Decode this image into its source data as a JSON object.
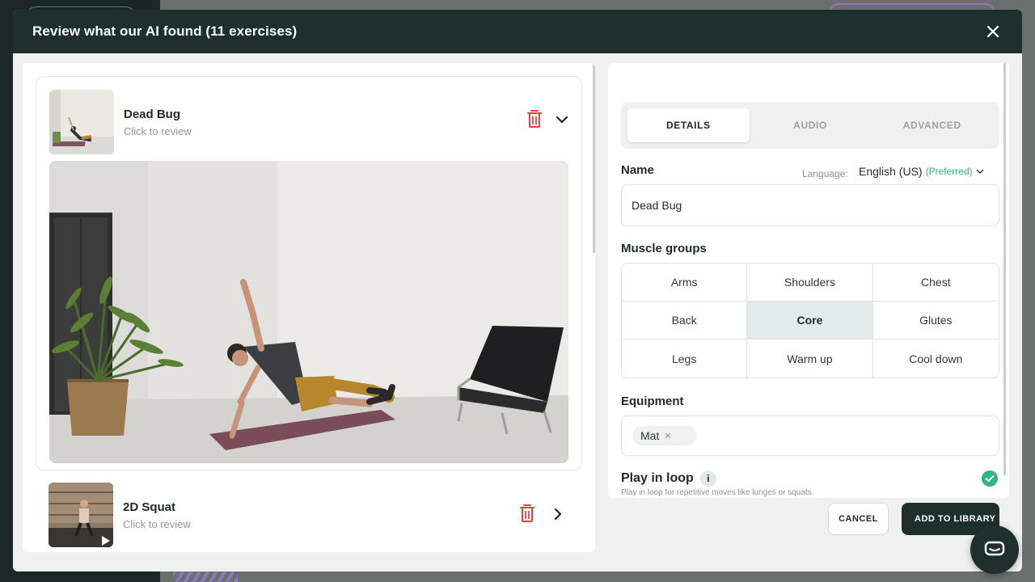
{
  "modal": {
    "title": "Review what our AI found (11 exercises)"
  },
  "exercises": [
    {
      "name": "Dead Bug",
      "subtitle": "Click to review",
      "expanded": true
    },
    {
      "name": "2D Squat",
      "subtitle": "Click to review",
      "expanded": false
    }
  ],
  "details": {
    "tabs": [
      {
        "label": "DETAILS",
        "active": true
      },
      {
        "label": "AUDIO",
        "active": false
      },
      {
        "label": "ADVANCED",
        "active": false
      }
    ],
    "name_label": "Name",
    "language_label": "Language:",
    "language_value": "English (US)",
    "language_preferred": "(Preferred)",
    "name_value": "Dead Bug",
    "muscle_groups_label": "Muscle groups",
    "muscle_groups": [
      {
        "label": "Arms",
        "selected": false
      },
      {
        "label": "Shoulders",
        "selected": false
      },
      {
        "label": "Chest",
        "selected": false
      },
      {
        "label": "Back",
        "selected": false
      },
      {
        "label": "Core",
        "selected": true
      },
      {
        "label": "Glutes",
        "selected": false
      },
      {
        "label": "Legs",
        "selected": false
      },
      {
        "label": "Warm up",
        "selected": false
      },
      {
        "label": "Cool down",
        "selected": false
      }
    ],
    "equipment_label": "Equipment",
    "equipment": [
      {
        "label": "Mat"
      }
    ],
    "play_in_loop_label": "Play in loop",
    "info_glyph": "i",
    "play_in_loop_desc": "Play in loop for repetitive moves like lunges or squats.",
    "play_in_loop_checked": true
  },
  "footer": {
    "cancel_label": "CANCEL",
    "add_label": "ADD TO LIBRARY"
  },
  "colors": {
    "header_bg": "#1f2f2c",
    "accent_green": "#2fb67c",
    "delete_red": "#e0433e"
  },
  "icons": {
    "close": "close-icon",
    "delete": "trash-icon",
    "expand": "chevron-down-icon",
    "collapse_right": "chevron-right-icon",
    "check": "check-icon",
    "chat": "chat-icon",
    "play": "play-icon"
  }
}
